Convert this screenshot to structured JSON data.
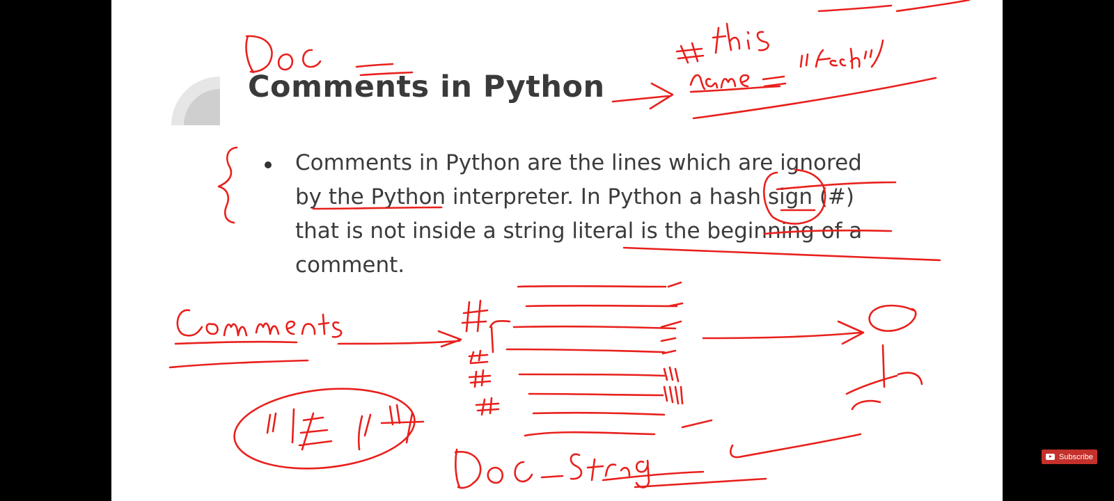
{
  "slide": {
    "title": "Comments in Python",
    "bullet": "Comments in Python are the lines which are ignored by the Python interpreter. In Python a hash sign (#) that is not inside a string literal is the beginning of a comment."
  },
  "overlay": {
    "subscribe_label": "Subscribe"
  },
  "colors": {
    "ink": "#e8201c",
    "title": "#3a3a3a",
    "subscribe_bg": "#c4302b"
  },
  "icons": [
    "youtube-play-icon",
    "quarter-circle-decoration"
  ]
}
